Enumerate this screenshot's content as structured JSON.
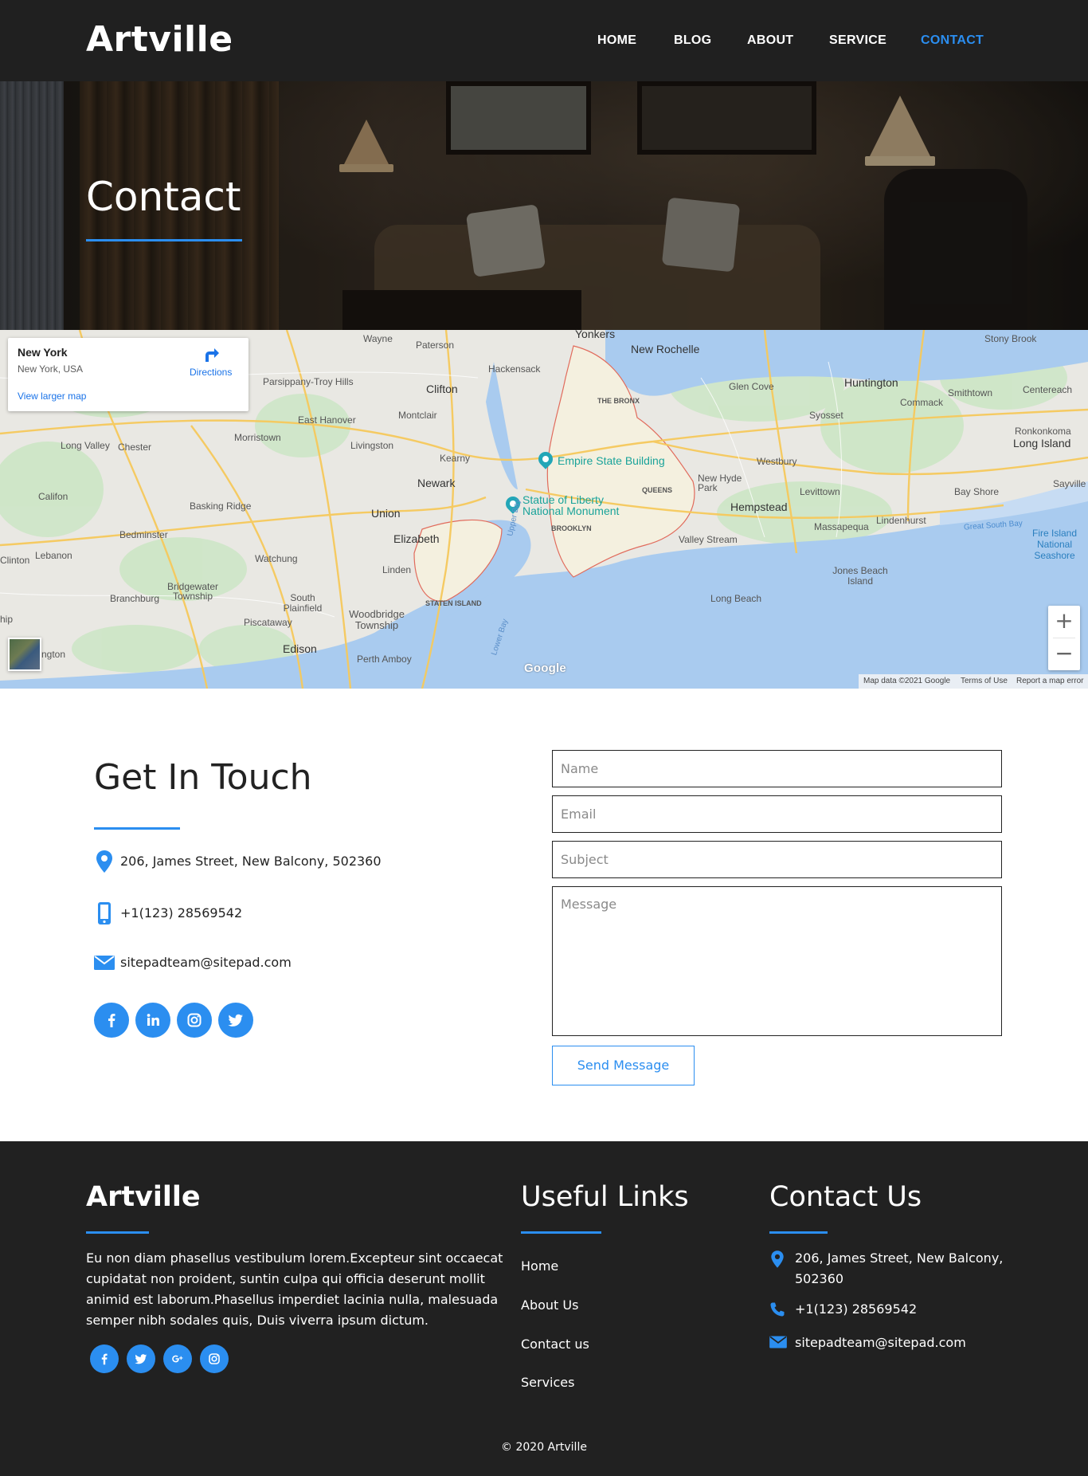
{
  "header": {
    "logo": "Artville",
    "nav": [
      {
        "label": "HOME",
        "active": false
      },
      {
        "label": "BLOG",
        "active": false
      },
      {
        "label": "ABOUT",
        "active": false
      },
      {
        "label": "SERVICE",
        "active": false
      },
      {
        "label": "CONTACT",
        "active": true
      }
    ]
  },
  "hero": {
    "title": "Contact"
  },
  "map": {
    "card": {
      "place": "New York",
      "address": "New York, USA",
      "directions": "Directions",
      "larger_map": "View larger map"
    },
    "labels": {
      "yonkers": "Yonkers",
      "new_rochelle": "New Rochelle",
      "wayne": "Wayne",
      "paterson": "Paterson",
      "hackensack": "Hackensack",
      "stony_brook": "Stony Brook",
      "huntington": "Huntington",
      "glen_cove": "Glen Cove",
      "smithtown": "Smithtown",
      "centereach": "Centereach",
      "commack": "Commack",
      "parsippany": "Parsippany-Troy Hills",
      "clifton": "Clifton",
      "the_bronx": "THE BRONX",
      "syosset": "Syosset",
      "ronkonkoma": "Ronkonkoma",
      "long_island": "Long Island",
      "east_hanover": "East Hanover",
      "montclair": "Montclair",
      "morristown": "Morristown",
      "livingston": "Livingston",
      "long_valley": "Long Valley",
      "chester": "Chester",
      "kearny": "Kearny",
      "empire": "Empire State Building",
      "westbury": "Westbury",
      "newark": "Newark",
      "bay_shore": "Bay Shore",
      "sayville": "Sayville",
      "califon": "Califon",
      "new_hyde_park": "New Hyde Park",
      "levittown": "Levittown",
      "queens": "QUEENS",
      "liberty": "Statue of Liberty National Monument",
      "union": "Union",
      "hempstead": "Hempstead",
      "basking_ridge": "Basking Ridge",
      "lindenhurst": "Lindenhurst",
      "brooklyn": "BROOKLYN",
      "massapequa": "Massapequa",
      "great_south_bay": "Great South Bay",
      "bedminster": "Bedminster",
      "elizabeth": "Elizabeth",
      "valley_stream": "Valley Stream",
      "fire_island": "Fire Island National Seashore",
      "lebanon": "Lebanon",
      "clinton": "Clinton",
      "watchung": "Watchung",
      "linden": "Linden",
      "jones_beach": "Jones Beach Island",
      "bridgewater": "Bridgewater Township",
      "branchburg": "Branchburg",
      "south_plainfield": "South Plainfield",
      "staten_island": "STATEN ISLAND",
      "long_beach": "Long Beach",
      "woodbridge": "Woodbridge Township",
      "piscataway": "Piscataway",
      "edison": "Edison",
      "perth_amboy": "Perth Amboy",
      "upper_bay": "Upper Bay",
      "lower_bay": "Lower Bay",
      "hip": "hip",
      "ngton": "ngton"
    },
    "google": "Google",
    "footer_data": "Map data ©2021 Google",
    "footer_terms": "Terms of Use",
    "footer_report": "Report a map error",
    "zoom_in": "+",
    "zoom_out": "−"
  },
  "contact": {
    "title": "Get In Touch",
    "address": "206, James Street, New Balcony, 502360",
    "phone": "+1(123) 28569542",
    "email": "sitepadteam@sitepad.com",
    "form": {
      "name_placeholder": "Name",
      "email_placeholder": "Email",
      "subject_placeholder": "Subject",
      "message_placeholder": "Message",
      "send_label": "Send Message"
    }
  },
  "footer": {
    "brand": "Artville",
    "about": "Eu non diam phasellus vestibulum lorem.Excepteur sint occaecat cupidatat non proident, suntin culpa qui officia deserunt mollit animid est laborum.Phasellus imperdiet lacinia nulla, malesuada semper nibh sodales quis, Duis viverra ipsum dictum.",
    "links_title": "Useful Links",
    "links": [
      "Home",
      "About Us",
      "Contact us",
      "Services"
    ],
    "contact_title": "Contact Us",
    "address": "206, James Street, New Balcony, 502360",
    "phone": "+1(123) 28569542",
    "email": "sitepadteam@sitepad.com",
    "copyright": "© 2020 Artville"
  },
  "colors": {
    "accent": "#2b8ef0",
    "dark": "#212121"
  }
}
